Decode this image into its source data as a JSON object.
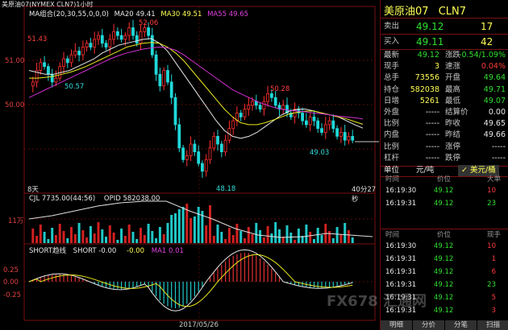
{
  "chart_header": {
    "title": "美原油07(NYMEX CLN7)1小时",
    "ma_label": "MA组合(20,30,55,0,0,0)",
    "ma20_label": "MA20 49.41",
    "ma30_label": "MA30 49.51",
    "ma55_label": "MA55 49.65"
  },
  "price_axis": {
    "ticks": [
      "51.00",
      "50.00"
    ],
    "high_marker": "51.43"
  },
  "price_annotations": {
    "high": "52.06",
    "low1": "50.57",
    "mid": "50.28",
    "low2": "49.03",
    "bottom": "48.18",
    "left_note": "8天",
    "right_note": "40分27秒"
  },
  "volume_header": {
    "cjl": "CJL  7735.00(44:56)",
    "opid": "OPID  582038.00"
  },
  "volume_axis": {
    "unit": "11万"
  },
  "macd_header": {
    "name": "SHORT趋线",
    "short": "SHORT  -0.00",
    "v2": "-0.00",
    "ma1": "MA1  0.01"
  },
  "macd_axis": {
    "ticks": [
      "0.25",
      "0.00",
      "-0.25"
    ]
  },
  "x_axis": {
    "date": "2017/05/26"
  },
  "chart_data": {
    "type": "line",
    "title": "美原油07(NYMEX CLN7)1小时",
    "ylim": [
      47.9,
      52.3
    ],
    "series": [
      {
        "name": "MA20",
        "values": [
          50.9,
          50.85,
          50.8,
          50.8,
          50.85,
          50.9,
          51.0,
          51.1,
          51.2,
          51.35,
          51.45,
          51.55,
          51.6,
          51.65,
          51.7,
          51.72,
          51.6,
          51.4,
          51.1,
          50.8,
          50.5,
          50.2,
          49.9,
          49.6,
          49.35,
          49.2,
          49.15,
          49.2,
          49.3,
          49.45,
          49.6,
          49.75,
          49.85,
          49.9,
          49.9,
          49.85,
          49.8,
          49.75,
          49.7,
          49.6,
          49.5,
          49.41
        ]
      },
      {
        "name": "MA30",
        "values": [
          50.7,
          50.7,
          50.72,
          50.75,
          50.8,
          50.85,
          50.92,
          51.0,
          51.1,
          51.2,
          51.3,
          51.4,
          51.5,
          51.55,
          51.6,
          51.62,
          51.6,
          51.5,
          51.35,
          51.15,
          50.9,
          50.65,
          50.4,
          50.15,
          49.9,
          49.7,
          49.55,
          49.5,
          49.5,
          49.55,
          49.62,
          49.7,
          49.78,
          49.82,
          49.85,
          49.85,
          49.8,
          49.75,
          49.7,
          49.65,
          49.58,
          49.51
        ]
      },
      {
        "name": "MA55",
        "values": [
          50.2,
          50.3,
          50.4,
          50.5,
          50.6,
          50.7,
          50.8,
          50.9,
          51.0,
          51.1,
          51.2,
          51.28,
          51.35,
          51.4,
          51.45,
          51.48,
          51.5,
          51.48,
          51.42,
          51.3,
          51.15,
          51.0,
          50.85,
          50.7,
          50.55,
          50.4,
          50.3,
          50.2,
          50.1,
          50.02,
          49.95,
          49.9,
          49.87,
          49.85,
          49.83,
          49.8,
          49.78,
          49.75,
          49.72,
          49.7,
          49.68,
          49.65
        ]
      }
    ]
  },
  "quote": {
    "name": "美原油07",
    "code": "CLN7",
    "sell": {
      "label": "卖出",
      "price": "49.12",
      "vol": "17"
    },
    "buy": {
      "label": "买入",
      "price": "49.11",
      "vol": "42"
    },
    "stats": [
      {
        "l1": "最新",
        "v1": "49.12",
        "c1": "green",
        "l2": "涨跌",
        "v2": "-0.54/1.09%",
        "c2": "green"
      },
      {
        "l1": "现手",
        "v1": "3",
        "c1": "yellow",
        "l2": "速涨",
        "v2": "0.04%",
        "c2": "red"
      },
      {
        "l1": "总手",
        "v1": "73556",
        "c1": "yellow",
        "l2": "开盘",
        "v2": "49.64",
        "c2": "green"
      },
      {
        "l1": "持仓",
        "v1": "582038",
        "c1": "yellow",
        "l2": "最高",
        "v2": "49.71",
        "c2": "green"
      },
      {
        "l1": "日增",
        "v1": "5261",
        "c1": "yellow",
        "l2": "最低",
        "v2": "49.07",
        "c2": "green"
      },
      {
        "l1": "外盘",
        "v1": "-----",
        "c1": "white",
        "l2": "结算价",
        "v2": "0.00",
        "c2": "white"
      },
      {
        "l1": "比例",
        "v1": "-----",
        "c1": "white",
        "l2": "昨收",
        "v2": "49.65",
        "c2": "white"
      },
      {
        "l1": "内盘",
        "v1": "-----",
        "c1": "white",
        "l2": "昨结",
        "v2": "49.66",
        "c2": "white"
      },
      {
        "l1": "比例",
        "v1": "-----",
        "c1": "white",
        "l2": "涨停",
        "v2": "-----",
        "c2": "white"
      },
      {
        "l1": "杠杆",
        "v1": "-----",
        "c1": "white",
        "l2": "跌停",
        "v2": "-----",
        "c2": "white"
      }
    ],
    "unit_row": {
      "label": "单位",
      "unit": "元/吨",
      "usd": "美元/桶"
    },
    "big_header": {
      "time": "时间",
      "price": "价位",
      "vol": "大单"
    },
    "big_trades": [
      {
        "time": "16:19:30",
        "price": "49.12",
        "vol": "10"
      },
      {
        "time": "16:19:31",
        "price": "49.12",
        "vol": "23"
      }
    ],
    "tick_header": {
      "time": "时间",
      "price": "价位",
      "vol": "现手"
    },
    "ticks": [
      {
        "time": "16:19:30",
        "price": "49.12",
        "vol": "10",
        "c": "red"
      },
      {
        "time": "16:19:31",
        "price": "49.12",
        "vol": "1",
        "c": "red"
      },
      {
        "time": "16:19:31",
        "price": "49.12",
        "vol": "6",
        "c": "red"
      },
      {
        "time": "16:19:31",
        "price": "49.12",
        "vol": "23",
        "c": "green"
      },
      {
        "time": "16:19:31",
        "price": "49.12",
        "vol": "5",
        "c": "red"
      },
      {
        "time": "16:19:31",
        "price": "49.12",
        "vol": "3",
        "c": "red"
      }
    ],
    "tabs": [
      "明细",
      "分价",
      "分笔",
      "扫描"
    ]
  },
  "watermark": {
    "text": "FX678 汇通网"
  }
}
